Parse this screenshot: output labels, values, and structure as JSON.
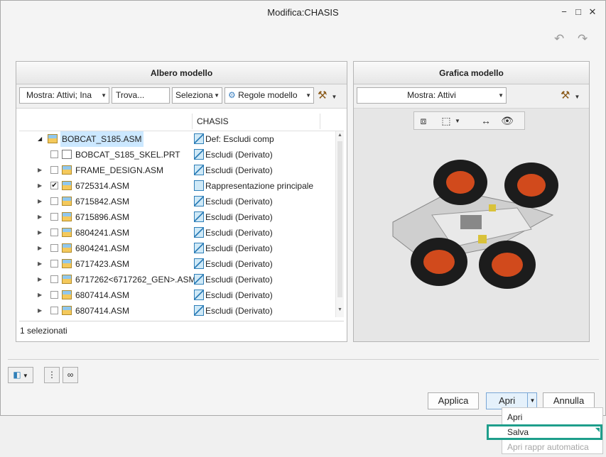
{
  "window": {
    "title": "Modifica:CHASIS",
    "min": "−",
    "max": "□",
    "close": "✕"
  },
  "undo_glyph": "↶",
  "redo_glyph": "↷",
  "left": {
    "title": "Albero modello",
    "show_dropdown": "Mostra: Attivi; Ina",
    "find_placeholder": "Trova...",
    "select_dropdown": "Seleziona",
    "rules_dropdown": "Regole modello",
    "column_header": "CHASIS",
    "rows": [
      {
        "name": "BOBCAT_S185.ASM",
        "value": "Def: Escludi comp"
      },
      {
        "name": "BOBCAT_S185_SKEL.PRT",
        "value": "Escludi (Derivato)"
      },
      {
        "name": "FRAME_DESIGN.ASM",
        "value": "Escludi (Derivato)"
      },
      {
        "name": "6725314.ASM",
        "value": "Rappresentazione principale"
      },
      {
        "name": "6715842.ASM",
        "value": "Escludi (Derivato)"
      },
      {
        "name": "6715896.ASM",
        "value": "Escludi (Derivato)"
      },
      {
        "name": "6804241.ASM",
        "value": "Escludi (Derivato)"
      },
      {
        "name": "6804241.ASM",
        "value": "Escludi (Derivato)"
      },
      {
        "name": "6717423.ASM",
        "value": "Escludi (Derivato)"
      },
      {
        "name": "6717262<6717262_GEN>.ASM",
        "value": "Escludi (Derivato)"
      },
      {
        "name": "6807414.ASM",
        "value": "Escludi (Derivato)"
      },
      {
        "name": "6807414.ASM",
        "value": "Escludi (Derivato)"
      }
    ],
    "status": "1 selezionati"
  },
  "right": {
    "title": "Grafica modello",
    "show_dropdown": "Mostra: Attivi"
  },
  "buttons": {
    "apply": "Applica",
    "open": "Apri",
    "cancel": "Annulla"
  },
  "menu": {
    "items": [
      "Apri",
      "Salva",
      "Apri rappr automatica"
    ]
  },
  "colors": {
    "highlight": "#1e9e8b",
    "selection": "#cce8ff"
  }
}
